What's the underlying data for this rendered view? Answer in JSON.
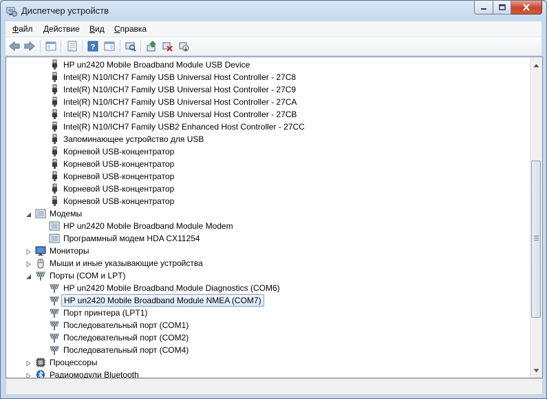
{
  "window": {
    "title": "Диспетчер устройств"
  },
  "menu": {
    "file": "Файл",
    "action": "Действие",
    "view": "Вид",
    "help": "Справка"
  },
  "toolbar": {
    "icons": [
      "back-icon",
      "forward-icon",
      "show-hide-console-tree-icon",
      "properties-icon",
      "help-icon",
      "action-pane-icon",
      "scan-hardware-icon",
      "update-driver-icon",
      "uninstall-icon",
      "disable-device-icon"
    ]
  },
  "tree": {
    "rows": [
      {
        "label": "HP un2420 Mobile Broadband Module USB Device",
        "icon": "usb-icon",
        "level": 2
      },
      {
        "label": "Intel(R) N10/ICH7 Family USB Universal Host Controller - 27C8",
        "icon": "usb-icon",
        "level": 2
      },
      {
        "label": "Intel(R) N10/ICH7 Family USB Universal Host Controller - 27C9",
        "icon": "usb-icon",
        "level": 2
      },
      {
        "label": "Intel(R) N10/ICH7 Family USB Universal Host Controller - 27CA",
        "icon": "usb-icon",
        "level": 2
      },
      {
        "label": "Intel(R) N10/ICH7 Family USB Universal Host Controller - 27CB",
        "icon": "usb-icon",
        "level": 2
      },
      {
        "label": "Intel(R) N10/ICH7 Family USB2 Enhanced Host Controller - 27CC",
        "icon": "usb-icon",
        "level": 2
      },
      {
        "label": "Запоминающее устройство для USB",
        "icon": "usb-icon",
        "level": 2
      },
      {
        "label": "Корневой USB-концентратор",
        "icon": "usb-icon",
        "level": 2
      },
      {
        "label": "Корневой USB-концентратор",
        "icon": "usb-icon",
        "level": 2
      },
      {
        "label": "Корневой USB-концентратор",
        "icon": "usb-icon",
        "level": 2
      },
      {
        "label": "Корневой USB-концентратор",
        "icon": "usb-icon",
        "level": 2
      },
      {
        "label": "Корневой USB-концентратор",
        "icon": "usb-icon",
        "level": 2
      },
      {
        "label": "Модемы",
        "icon": "modem-icon",
        "level": 1,
        "expander": "expanded"
      },
      {
        "label": "HP un2420 Mobile Broadband Module Modem",
        "icon": "modem-icon",
        "level": 2
      },
      {
        "label": "Программный модем HDA CX11254",
        "icon": "modem-icon",
        "level": 2
      },
      {
        "label": "Мониторы",
        "icon": "monitor-icon",
        "level": 1,
        "expander": "collapsed"
      },
      {
        "label": "Мыши и иные указывающие устройства",
        "icon": "mouse-icon",
        "level": 1,
        "expander": "collapsed"
      },
      {
        "label": "Порты (COM и LPT)",
        "icon": "port-icon",
        "level": 1,
        "expander": "expanded"
      },
      {
        "label": "HP un2420 Mobile Broadband Module Diagnostics (COM6)",
        "icon": "port-icon",
        "level": 2
      },
      {
        "label": "HP un2420 Mobile Broadband Module NMEA (COM7)",
        "icon": "port-icon",
        "level": 2,
        "selected": true
      },
      {
        "label": "Порт принтера (LPT1)",
        "icon": "port-icon",
        "level": 2
      },
      {
        "label": "Последовательный порт (COM1)",
        "icon": "port-icon",
        "level": 2
      },
      {
        "label": "Последовательный порт (COM2)",
        "icon": "port-icon",
        "level": 2
      },
      {
        "label": "Последовательный порт (COM4)",
        "icon": "port-icon",
        "level": 2
      },
      {
        "label": "Процессоры",
        "icon": "processor-icon",
        "level": 1,
        "expander": "collapsed"
      },
      {
        "label": "Радиомодули Bluetooth",
        "icon": "bluetooth-icon",
        "level": 1,
        "expander": "collapsed"
      }
    ]
  },
  "colors": {
    "selection_border": "#7da2ce",
    "window_frame": "#c6d8ee"
  }
}
